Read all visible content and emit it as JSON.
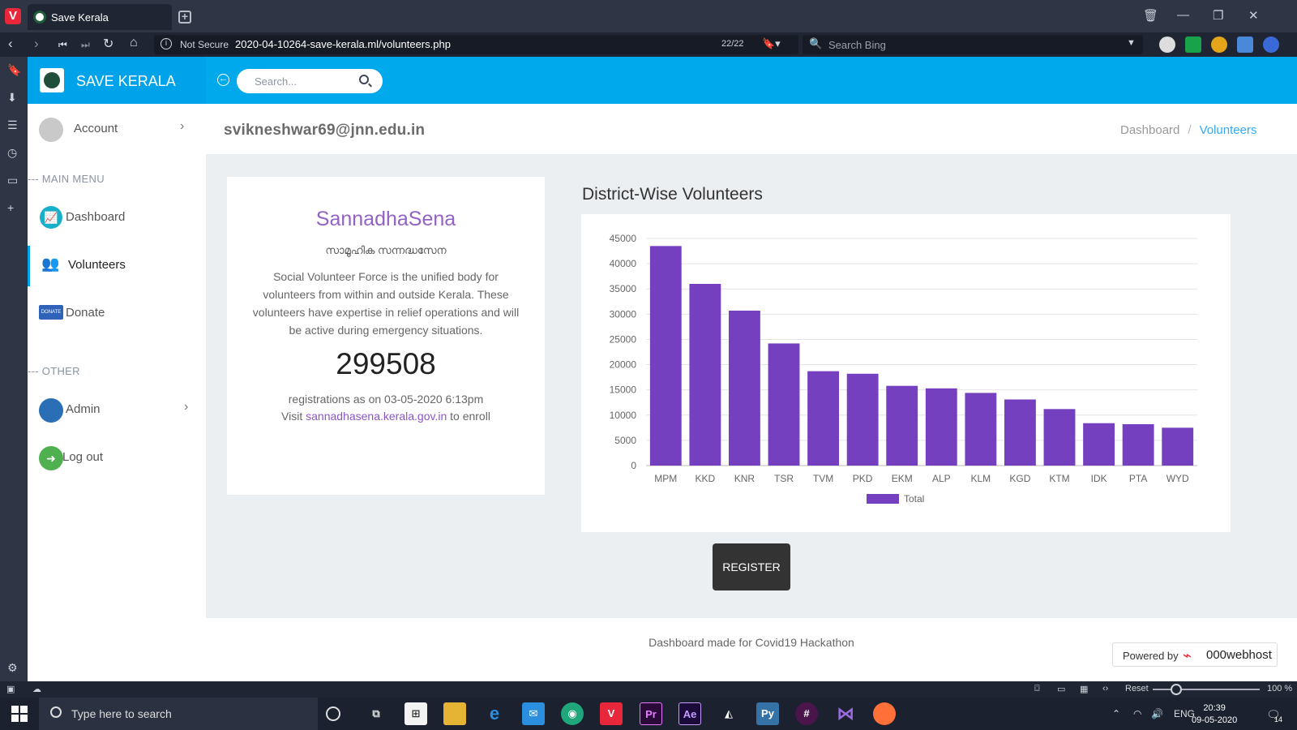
{
  "browser": {
    "tab_title": "Save Kerala",
    "security_label": "Not Secure",
    "url": "2020-04-10264-save-kerala.ml/volunteers.php",
    "tab_count": "22/22",
    "search_placeholder": "Search Bing"
  },
  "app": {
    "brand": "SAVE KERALA",
    "search_placeholder": "Search...",
    "user_email": "svikneshwar69@jnn.edu.in"
  },
  "sidebar": {
    "account_label": "Account",
    "main_menu_heading": "--- MAIN MENU",
    "items": [
      {
        "label": "Dashboard",
        "icon": "dashboard-chart-icon"
      },
      {
        "label": "Volunteers",
        "icon": "volunteers-group-icon"
      },
      {
        "label": "Donate",
        "icon": "donate-icon"
      }
    ],
    "other_heading": "--- OTHER",
    "admin_label": "Admin",
    "logout_label": "Log out"
  },
  "breadcrumb": {
    "home": "Dashboard",
    "separator": "/",
    "current": "Volunteers"
  },
  "card": {
    "title": "SannadhaSena",
    "subtitle": "സാമൂഹിക സന്നദ്ധസേന",
    "description": "Social Volunteer Force is the unified body for volunteers from within and outside Kerala. These volunteers have expertise in relief operations and will be active during emergency situations.",
    "count": "299508",
    "registrations_text": "registrations as on 03-05-2020 6:13pm",
    "visit_prefix": "Visit",
    "visit_link": "sannadhasena.kerala.gov.in",
    "visit_suffix": "to enroll"
  },
  "chart_section_title": "District-Wise Volunteers",
  "chart_data": {
    "type": "bar",
    "categories": [
      "MPM",
      "KKD",
      "KNR",
      "TSR",
      "TVM",
      "PKD",
      "EKM",
      "ALP",
      "KLM",
      "KGD",
      "KTM",
      "IDK",
      "PTA",
      "WYD"
    ],
    "series": [
      {
        "name": "Total",
        "values": [
          43500,
          36000,
          30700,
          24200,
          18700,
          18200,
          15800,
          15300,
          14400,
          13100,
          11200,
          8400,
          8200,
          7500
        ]
      }
    ],
    "ylim": [
      0,
      45000
    ],
    "yticks": [
      0,
      5000,
      10000,
      15000,
      20000,
      25000,
      30000,
      35000,
      40000,
      45000
    ],
    "grid": true,
    "legend": "bottom",
    "bar_color": "#7540c0"
  },
  "register_label": "REGISTER",
  "footer_text": "Dashboard made for Covid19 Hackathon",
  "powered": {
    "prefix": "Powered by",
    "host": "000webhost"
  },
  "statusbar": {
    "reset": "Reset",
    "zoom": "100 %"
  },
  "taskbar": {
    "search_placeholder": "Type here to search",
    "language": "ENG",
    "time": "20:39",
    "date": "09-05-2020",
    "notification_count": "14"
  }
}
